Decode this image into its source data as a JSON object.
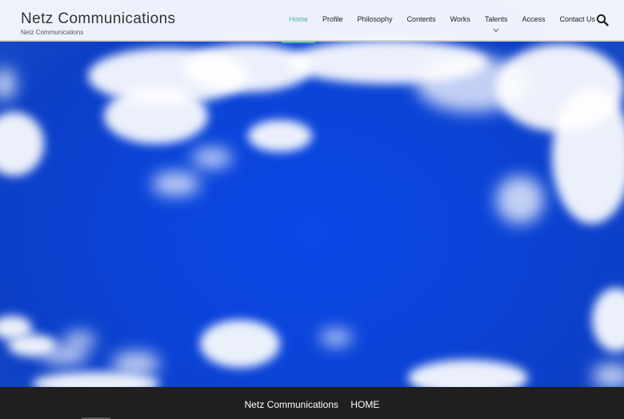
{
  "site": {
    "title": "Netz Communications",
    "subtitle": "Netz Communications"
  },
  "nav": {
    "items": [
      {
        "label": "Home",
        "active": true
      },
      {
        "label": "Profile"
      },
      {
        "label": "Philosophy"
      },
      {
        "label": "Contents"
      },
      {
        "label": "Works"
      },
      {
        "label": "Talents",
        "has_dropdown": true
      },
      {
        "label": "Access"
      },
      {
        "label": "Contact Us"
      }
    ],
    "search_icon": "search-icon"
  },
  "hero": {
    "image": "blue-sky-with-clouds"
  },
  "footer": {
    "site_name": "Netz Communications",
    "page_name": "HOME"
  },
  "colors": {
    "accent": "#3fb6a8",
    "sky": "#0b44d8",
    "footer_bg": "#1f1f1f"
  }
}
